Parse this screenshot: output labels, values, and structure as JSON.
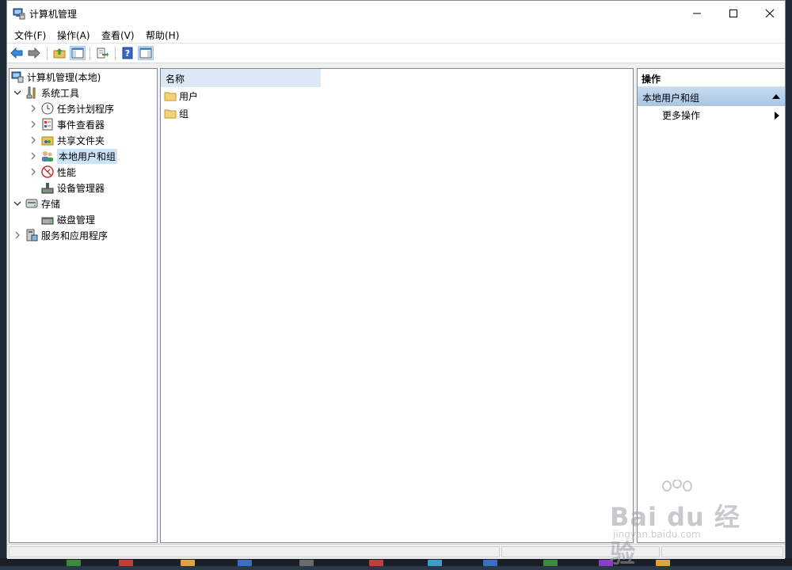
{
  "window": {
    "title": "计算机管理"
  },
  "menu": [
    {
      "label": "文件(F)"
    },
    {
      "label": "操作(A)"
    },
    {
      "label": "查看(V)"
    },
    {
      "label": "帮助(H)"
    }
  ],
  "toolbar": {
    "icons": [
      "back-arrow-icon",
      "forward-arrow-icon",
      "up-folder-icon",
      "show-hide-tree-icon",
      "export-list-icon",
      "help-icon",
      "show-hide-action-pane-icon"
    ]
  },
  "tree": {
    "root": "计算机管理(本地)",
    "items": [
      {
        "label": "系统工具"
      },
      {
        "label": "任务计划程序"
      },
      {
        "label": "事件查看器"
      },
      {
        "label": "共享文件夹"
      },
      {
        "label": "本地用户和组"
      },
      {
        "label": "性能"
      },
      {
        "label": "设备管理器"
      },
      {
        "label": "存储"
      },
      {
        "label": "磁盘管理"
      },
      {
        "label": "服务和应用程序"
      }
    ],
    "selected": "本地用户和组"
  },
  "center": {
    "column_header": "名称",
    "rows": [
      {
        "label": "用户"
      },
      {
        "label": "组"
      }
    ]
  },
  "actions": {
    "title": "操作",
    "group": "本地用户和组",
    "items": [
      {
        "label": "更多操作"
      }
    ]
  },
  "watermark": {
    "main": "Bai du 经验",
    "sub": "jingyan.baidu.com"
  },
  "colors": {
    "selection": "#cce4f7",
    "column_header": "#dbe9f7",
    "action_group": "#b9d1ea",
    "folder": "#f3d37a"
  }
}
